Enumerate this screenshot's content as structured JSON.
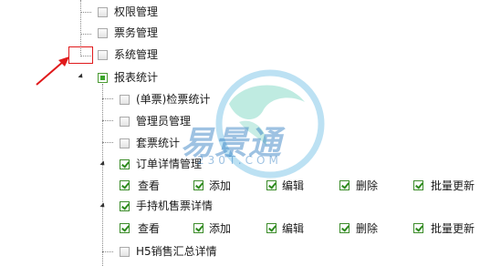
{
  "tree": {
    "top_items": [
      {
        "label": "权限管理",
        "checked": false
      },
      {
        "label": "票务管理",
        "checked": false
      },
      {
        "label": "系统管理",
        "checked": false
      }
    ],
    "report": {
      "label": "报表统计",
      "state": "partial",
      "children": [
        {
          "label": "(单票)检票统计",
          "checked": false
        },
        {
          "label": "管理员管理",
          "checked": false
        },
        {
          "label": "套票统计",
          "checked": false
        },
        {
          "label": "订单详情管理",
          "checked": true,
          "perms": [
            "查看",
            "添加",
            "编辑",
            "删除",
            "批量更新"
          ]
        },
        {
          "label": "手持机售票详情",
          "checked": true,
          "perms": [
            "查看",
            "添加",
            "编辑",
            "删除",
            "批量更新"
          ]
        },
        {
          "label": "H5销售汇总详情",
          "checked": false
        }
      ]
    }
  },
  "watermark": {
    "brand": "易景通",
    "domain": "230T.COM"
  },
  "colors": {
    "annotation": "#e0191b",
    "check_green": "#2e8b1e"
  }
}
